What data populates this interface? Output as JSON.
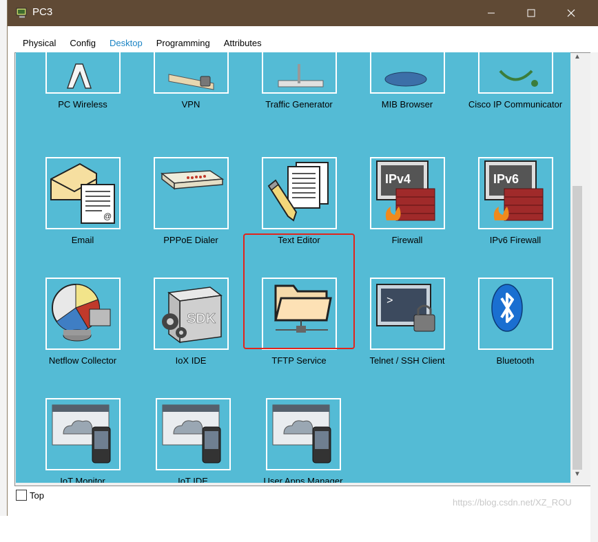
{
  "window": {
    "title": "PC3",
    "icons": {
      "app": "pc-icon",
      "minimize": "minimize-icon",
      "maximize": "maximize-icon",
      "close": "close-icon"
    }
  },
  "tabs": [
    {
      "label": "Physical",
      "active": false
    },
    {
      "label": "Config",
      "active": false
    },
    {
      "label": "Desktop",
      "active": true
    },
    {
      "label": "Programming",
      "active": false
    },
    {
      "label": "Attributes",
      "active": false
    }
  ],
  "apps": {
    "row1": [
      {
        "label": "PC Wireless",
        "icon": "pc-wireless-icon"
      },
      {
        "label": "VPN",
        "icon": "vpn-icon"
      },
      {
        "label": "Traffic Generator",
        "icon": "traffic-generator-icon"
      },
      {
        "label": "MIB Browser",
        "icon": "mib-browser-icon"
      },
      {
        "label": "Cisco IP Communicator",
        "icon": "ip-communicator-icon"
      }
    ],
    "row2": [
      {
        "label": "Email",
        "icon": "email-icon"
      },
      {
        "label": "PPPoE Dialer",
        "icon": "pppoe-dialer-icon"
      },
      {
        "label": "Text Editor",
        "icon": "text-editor-icon"
      },
      {
        "label": "Firewall",
        "icon": "firewall-icon",
        "badge": "IPv4"
      },
      {
        "label": "IPv6 Firewall",
        "icon": "ipv6-firewall-icon",
        "badge": "IPv6"
      }
    ],
    "row3": [
      {
        "label": "Netflow Collector",
        "icon": "netflow-collector-icon"
      },
      {
        "label": "IoX IDE",
        "icon": "iox-ide-icon",
        "badge": "SDK"
      },
      {
        "label": "TFTP Service",
        "icon": "folder-icon",
        "highlighted": true
      },
      {
        "label": "Telnet / SSH Client",
        "icon": "terminal-icon",
        "badge": ">"
      },
      {
        "label": "Bluetooth",
        "icon": "bluetooth-icon"
      }
    ],
    "row4": [
      {
        "label": "IoT Monitor",
        "icon": "iot-monitor-icon"
      },
      {
        "label": "IoT IDE",
        "icon": "iot-ide-icon"
      },
      {
        "label": "User Apps Manager",
        "icon": "user-apps-manager-icon"
      }
    ]
  },
  "footer": {
    "top_checkbox_label": "Top",
    "top_checked": false
  },
  "watermark": "https://blog.csdn.net/XZ_ROU",
  "colors": {
    "titlebar": "#604a35",
    "desktop_bg": "#54bbd5",
    "active_tab": "#1a83c4",
    "highlight": "#e2231a"
  }
}
